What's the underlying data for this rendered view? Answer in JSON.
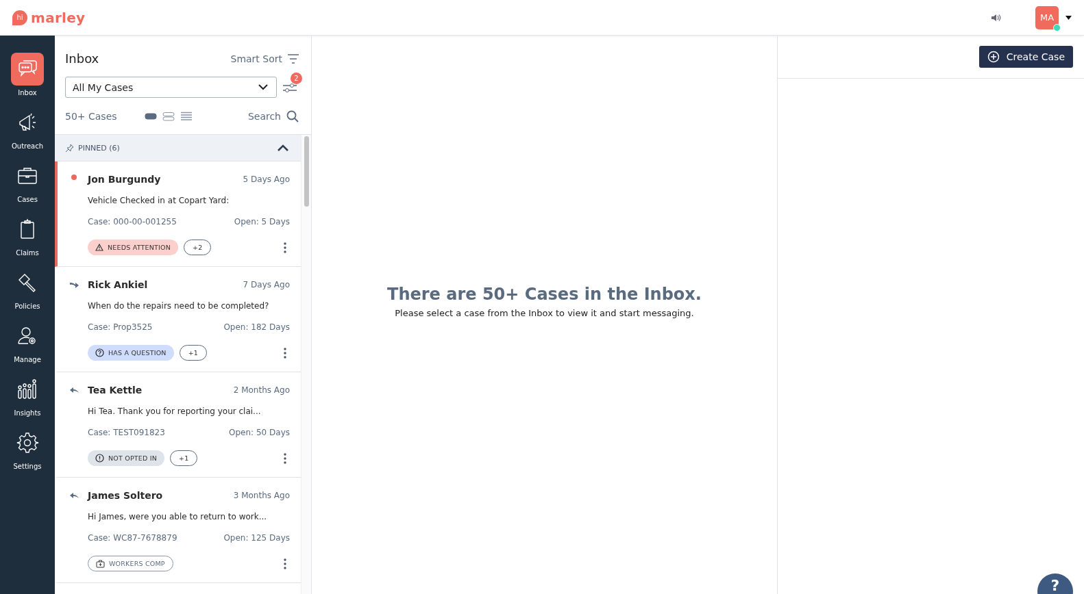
{
  "header": {
    "logo_badge": "hi",
    "logo_text": "marley",
    "avatar": {
      "initials": "MA",
      "online": true
    }
  },
  "nav": [
    {
      "label": "Inbox",
      "selected": true
    },
    {
      "label": "Outreach",
      "selected": false
    },
    {
      "label": "Cases",
      "selected": false
    },
    {
      "label": "Claims",
      "selected": false
    },
    {
      "label": "Policies",
      "selected": false
    },
    {
      "label": "Manage",
      "selected": false
    },
    {
      "label": "Insights",
      "selected": false
    },
    {
      "label": "Settings",
      "selected": false
    }
  ],
  "inbox": {
    "title": "Inbox",
    "sort_label": "Smart Sort",
    "filter": {
      "value": "All My Cases"
    },
    "filter_badge": "2",
    "count": "50+ Cases",
    "view_modes": [
      {
        "selected": true
      },
      {
        "selected": false
      },
      {
        "selected": false
      }
    ],
    "search_label": "Search",
    "pinned": {
      "label": "PINNED (6)",
      "expanded": true
    },
    "cases": [
      {
        "kind": "unread",
        "selected": true,
        "name": "Jon Burgundy",
        "time": "5 Days Ago",
        "message": "Vehicle Checked in at Copart Yard:",
        "case": "Case: 000-00-001255",
        "open": "Open: 5 Days",
        "tags": [
          {
            "kind": "attention",
            "label": "NEEDS ATTENTION"
          },
          {
            "kind": "count",
            "label": "+2"
          }
        ]
      },
      {
        "kind": "forwarded",
        "selected": false,
        "name": "Rick Ankiel",
        "time": "7 Days Ago",
        "message": "When do the repairs need to be completed?",
        "case": "Case: Prop3525",
        "open": "Open: 182 Days",
        "tags": [
          {
            "kind": "question",
            "label": "HAS A QUESTION"
          },
          {
            "kind": "count",
            "label": "+1"
          }
        ]
      },
      {
        "kind": "replied",
        "selected": false,
        "name": "Tea Kettle",
        "time": "2 Months Ago",
        "message": "Hi Tea. Thank you for reporting your clai...",
        "case": "Case: TEST091823",
        "open": "Open: 50 Days",
        "tags": [
          {
            "kind": "optin",
            "label": "NOT OPTED IN"
          },
          {
            "kind": "count",
            "label": "+1"
          }
        ]
      },
      {
        "kind": "replied",
        "selected": false,
        "name": "James Soltero",
        "time": "3 Months Ago",
        "message": "Hi James, were you able to return to work...",
        "case": "Case: WC87-7678879",
        "open": "Open: 125 Days",
        "tags": [
          {
            "kind": "workers",
            "label": "WORKERS COMP"
          }
        ]
      }
    ]
  },
  "empty_state": {
    "title": "There are 50+ Cases in the Inbox.",
    "subtitle": "Please select a case from the Inbox to view it and start messaging."
  },
  "create_button": "Create Case",
  "help_button": "?"
}
